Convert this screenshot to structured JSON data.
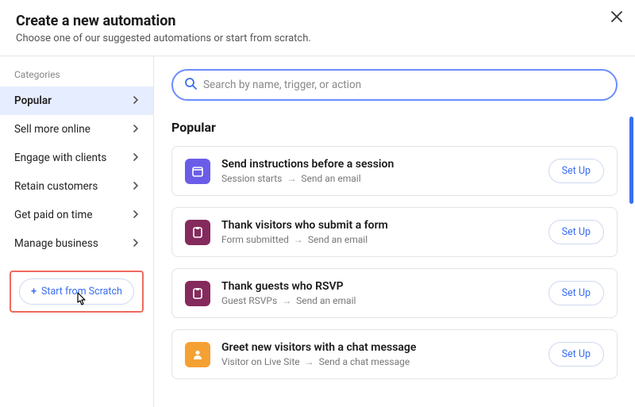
{
  "header": {
    "title": "Create a new automation",
    "subtitle": "Choose one of our suggested automations or start from scratch."
  },
  "sidebar": {
    "heading": "Categories",
    "items": [
      {
        "label": "Popular"
      },
      {
        "label": "Sell more online"
      },
      {
        "label": "Engage with clients"
      },
      {
        "label": "Retain customers"
      },
      {
        "label": "Get paid on time"
      },
      {
        "label": "Manage business"
      }
    ],
    "scratch_label": "Start from Scratch"
  },
  "search": {
    "placeholder": "Search by name, trigger, or action"
  },
  "section": {
    "title": "Popular"
  },
  "cards": [
    {
      "title": "Send instructions before a session",
      "trigger": "Session starts",
      "action": "Send an email",
      "setup": "Set Up"
    },
    {
      "title": "Thank visitors who submit a form",
      "trigger": "Form submitted",
      "action": "Send an email",
      "setup": "Set Up"
    },
    {
      "title": "Thank guests who RSVP",
      "trigger": "Guest RSVPs",
      "action": "Send an email",
      "setup": "Set Up"
    },
    {
      "title": "Greet new visitors with a chat message",
      "trigger": "Visitor on Live Site",
      "action": "Send a chat message",
      "setup": "Set Up"
    }
  ]
}
